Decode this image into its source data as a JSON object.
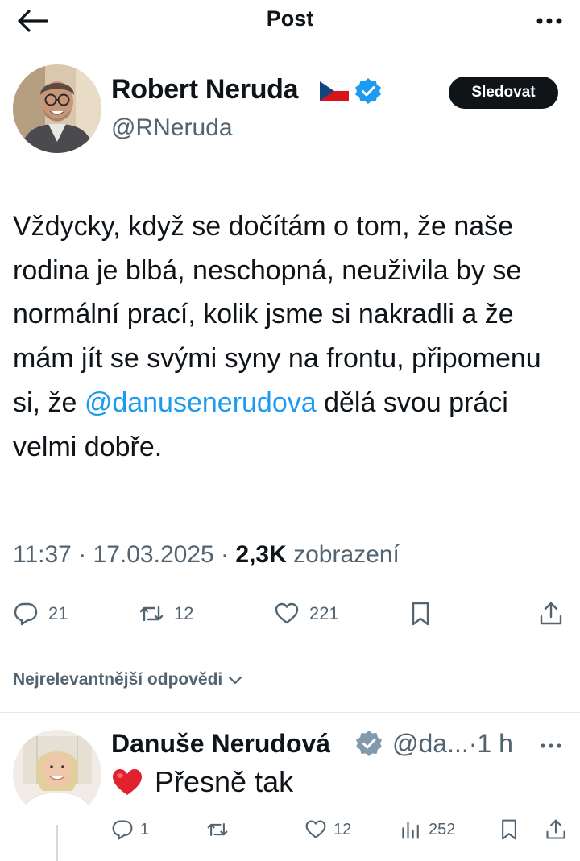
{
  "header": {
    "title": "Post"
  },
  "author": {
    "name": "Robert Neruda",
    "handle": "@RNeruda",
    "follow_label": "Sledovat"
  },
  "post": {
    "text_before": "Vždycky, když se dočítám o tom, že naše rodina je blbá, neschopná, neuživila by se normální prací, kolik jsme si nakradli a že mám jít se svými syny na frontu, připomenu si, že ",
    "mention": "@danusenerudova",
    "text_after": " dělá svou práci velmi dobře.",
    "time": "11:37",
    "date": "17.03.2025",
    "views": "2,3K",
    "views_label": "zobrazení",
    "separator": "·"
  },
  "actions": {
    "replies": "21",
    "reposts": "12",
    "likes": "221"
  },
  "sort_label": "Nejrelevantnější odpovědi",
  "reply": {
    "name": "Danuše Nerudová",
    "handle": "@da...",
    "time": "·1 h",
    "emoji": "❤️",
    "text": "Přesně tak",
    "replies": "1",
    "likes": "12",
    "views": "252"
  },
  "colors": {
    "accent": "#1d9bf0",
    "text": "#0f1419",
    "muted": "#536471",
    "heart": "#f91880"
  }
}
